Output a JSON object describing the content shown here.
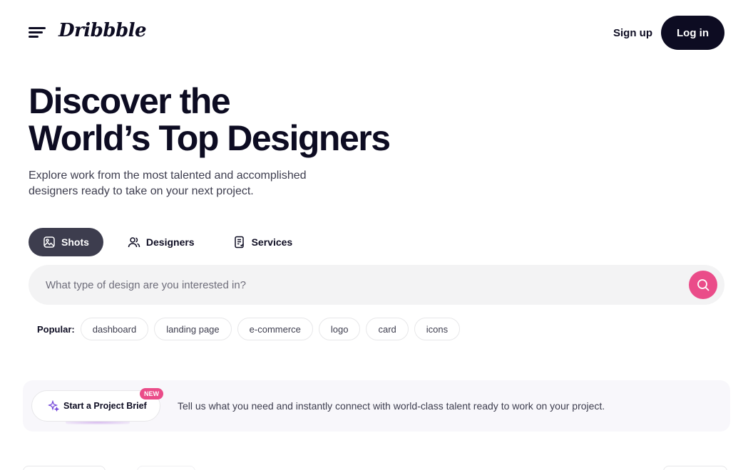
{
  "header": {
    "logo_text": "Dribbble",
    "signup_label": "Sign up",
    "login_label": "Log in"
  },
  "hero": {
    "title_line1": "Discover the",
    "title_line2": "World’s Top Designers",
    "subtitle": "Explore work from the most talented and accomplished designers ready to take on your next project."
  },
  "tabs": [
    {
      "label": "Shots",
      "icon": "image-icon",
      "active": true
    },
    {
      "label": "Designers",
      "icon": "users-icon",
      "active": false
    },
    {
      "label": "Services",
      "icon": "document-icon",
      "active": false
    }
  ],
  "search": {
    "placeholder": "What type of design are you interested in?",
    "value": ""
  },
  "popular": {
    "label": "Popular:",
    "tags": [
      "dashboard",
      "landing page",
      "e-commerce",
      "logo",
      "card",
      "icons"
    ]
  },
  "brief": {
    "button_label": "Start a Project Brief",
    "badge": "NEW",
    "description": "Tell us what you need and instantly connect with world-class talent ready to work on your project."
  },
  "colors": {
    "accent": "#ea4c89",
    "dark": "#0d0c22",
    "tab_active": "#3d3d4e"
  }
}
